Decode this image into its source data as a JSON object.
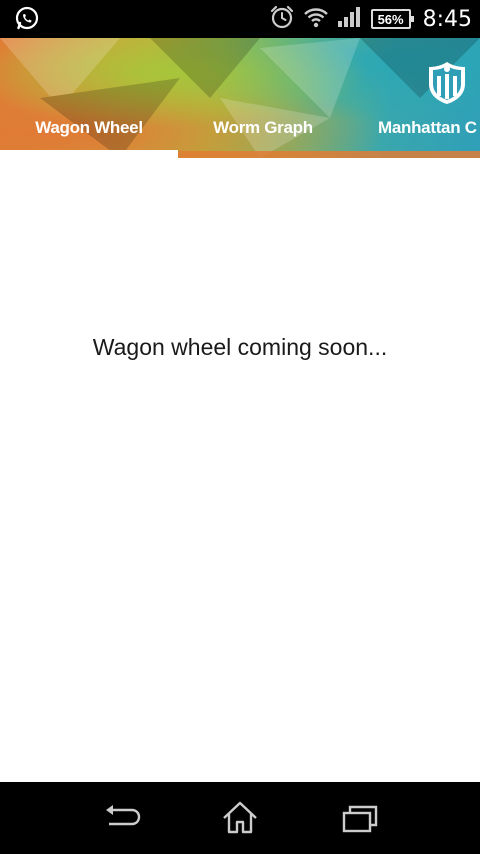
{
  "status_bar": {
    "notification_icon": "whatsapp-icon",
    "icons": [
      "alarm-icon",
      "wifi-icon",
      "signal-icon"
    ],
    "battery_percent": "56%",
    "time": "8:45"
  },
  "header": {
    "logo_icon": "team-shield-logo",
    "accent_color": "#e07d35",
    "gradient_colors": [
      "#e07d35",
      "#a8c240",
      "#2f9fb8"
    ]
  },
  "tabs": [
    {
      "label": "Wagon Wheel",
      "selected": true
    },
    {
      "label": "Worm Graph",
      "selected": false
    },
    {
      "label": "Manhattan C",
      "selected": false
    }
  ],
  "content": {
    "message": "Wagon wheel coming soon..."
  },
  "nav_bar": {
    "buttons": [
      "back-icon",
      "home-icon",
      "recents-icon"
    ]
  }
}
